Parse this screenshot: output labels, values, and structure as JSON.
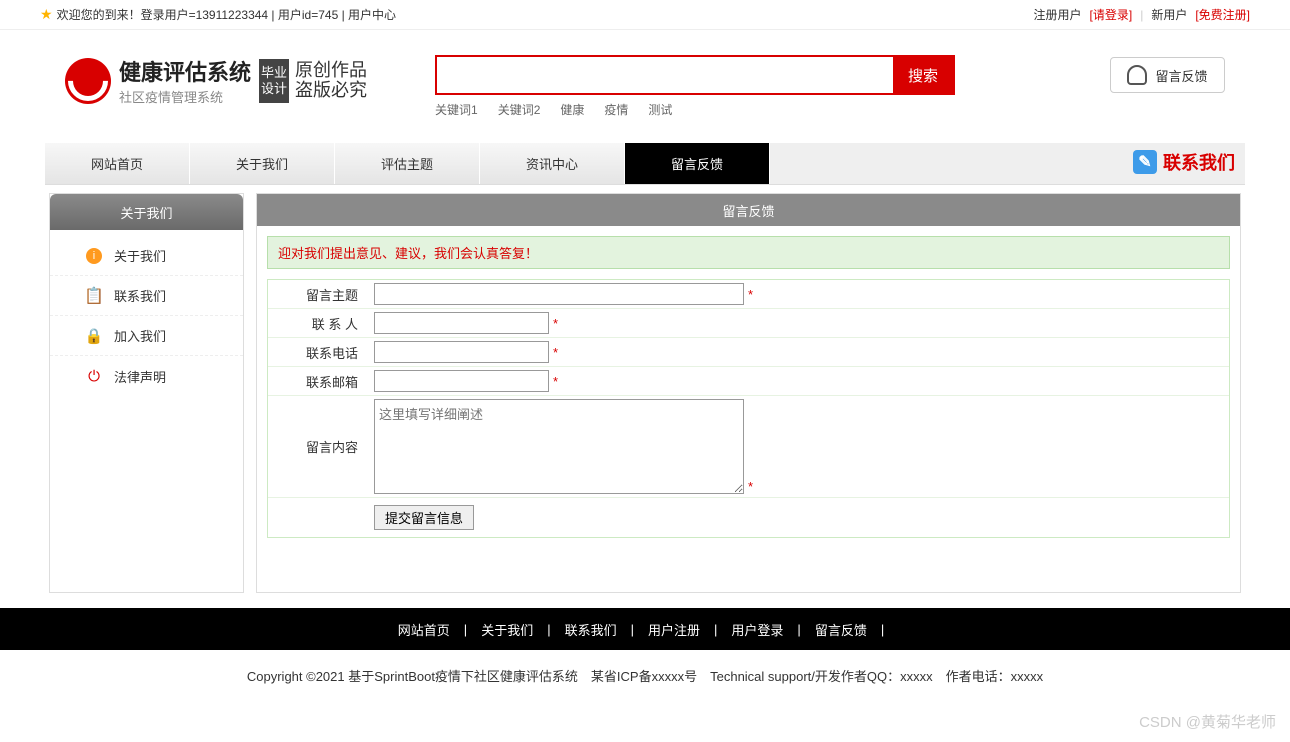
{
  "topbar": {
    "welcome": "欢迎您的到来！登录用户=13911223344 | 用户id=745 | 用户中心",
    "reg_user": "注册用户",
    "please_login": "[请登录]",
    "new_user": "新用户",
    "free_reg": "[免费注册]"
  },
  "logo": {
    "title": "健康评估系统",
    "subtitle": "社区疫情管理系统",
    "badge1": "毕业",
    "badge2": "设计",
    "script1": "原创作品",
    "script2": "盗版必究"
  },
  "search": {
    "button": "搜索",
    "keywords": [
      "关键词1",
      "关键词2",
      "健康",
      "疫情",
      "测试"
    ],
    "feedback_btn": "留言反馈"
  },
  "nav": {
    "items": [
      "网站首页",
      "关于我们",
      "评估主题",
      "资讯中心",
      "留言反馈"
    ],
    "contact": "联系我们"
  },
  "sidebar": {
    "header": "关于我们",
    "items": [
      {
        "label": "关于我们"
      },
      {
        "label": "联系我们"
      },
      {
        "label": "加入我们"
      },
      {
        "label": "法律声明"
      }
    ]
  },
  "main": {
    "header": "留言反馈",
    "tip": "迎对我们提出意见、建议，我们会认真答复！",
    "labels": {
      "subject": "留言主题",
      "contact": "联 系 人",
      "phone": "联系电话",
      "email": "联系邮箱",
      "content": "留言内容"
    },
    "placeholder_content": "这里填写详细阐述",
    "submit": "提交留言信息",
    "req": "*"
  },
  "footer": {
    "links": [
      "网站首页",
      "关于我们",
      "联系我们",
      "用户注册",
      "用户登录",
      "留言反馈"
    ],
    "copyright": "Copyright ©2021 基于SprintBoot疫情下社区健康评估系统　某省ICP备xxxxx号　Technical support/开发作者QQ：xxxxx　作者电话：xxxxx"
  },
  "watermark": "CSDN @黄菊华老师"
}
